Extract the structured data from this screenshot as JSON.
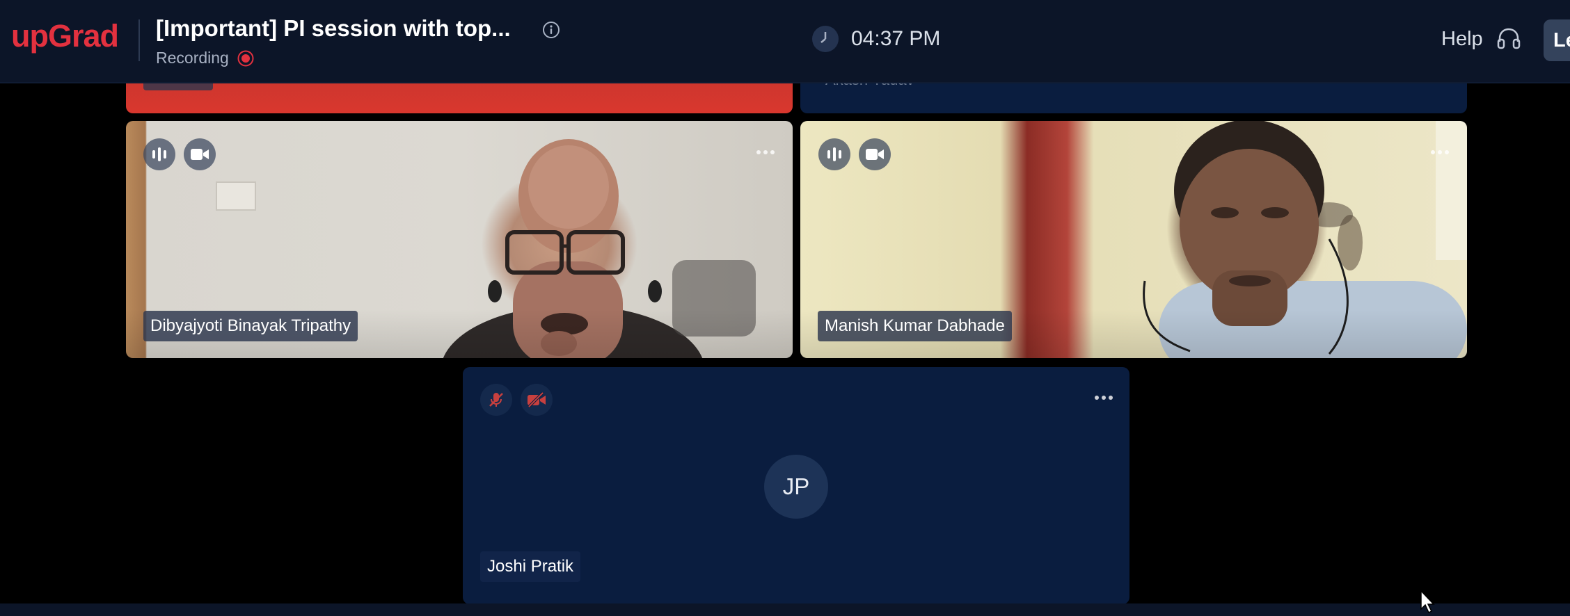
{
  "header": {
    "logo_text": "upGrad",
    "session_title": "[Important] PI session with top...",
    "recording_label": "Recording",
    "time": "04:37 PM",
    "help_label": "Help",
    "leave_label": "Le"
  },
  "participants": [
    {
      "name": "Dibyajyoti Binayak Tripathy",
      "mic": "on",
      "camera": "on"
    },
    {
      "name": "Manish Kumar Dabhade",
      "mic": "on",
      "camera": "on"
    },
    {
      "name": "Joshi Pratik",
      "initials": "JP",
      "mic": "muted",
      "camera": "off"
    }
  ],
  "partial_tiles": [
    {
      "name": "Akash Yadav"
    }
  ],
  "colors": {
    "topbar_bg": "#0c1528",
    "logo_red": "#e3313f",
    "tile_bg": "#0a1d3f",
    "recording_red": "#e3313f",
    "muted_red": "#c8403f"
  },
  "icons": [
    "info-icon",
    "record-dot-icon",
    "clock-icon",
    "headset-icon",
    "audio-level-icon",
    "video-camera-icon",
    "mic-muted-icon",
    "camera-off-icon",
    "more-options-icon",
    "mouse-cursor-icon"
  ]
}
